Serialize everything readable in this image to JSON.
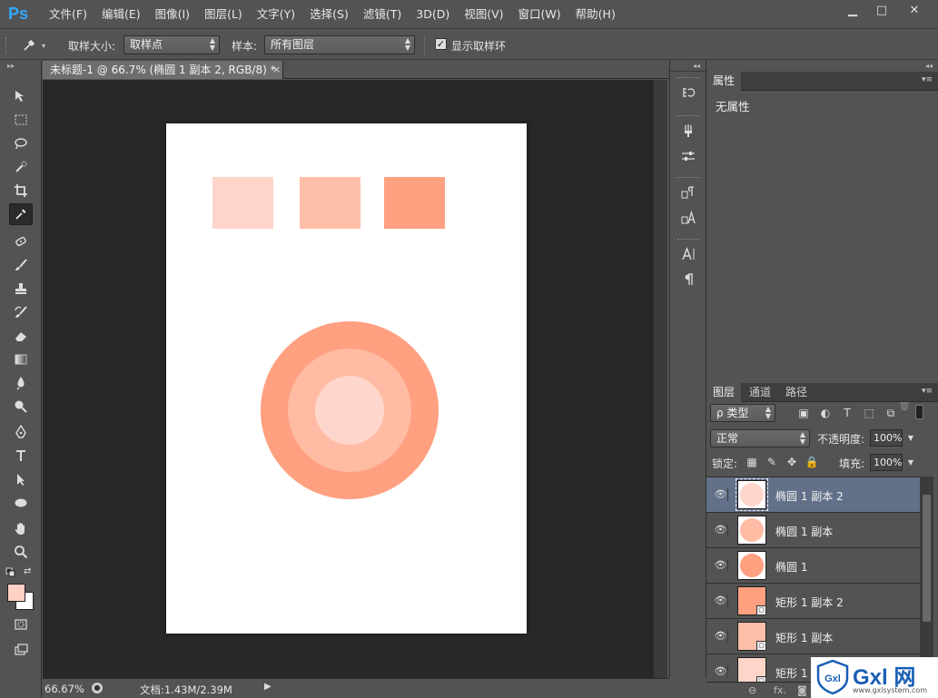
{
  "app": {
    "logo": "Ps"
  },
  "menu": [
    "文件(F)",
    "编辑(E)",
    "图像(I)",
    "图层(L)",
    "文字(Y)",
    "选择(S)",
    "滤镜(T)",
    "3D(D)",
    "视图(V)",
    "窗口(W)",
    "帮助(H)"
  ],
  "window_controls": {
    "minimize": "▁",
    "maximize": "□",
    "close": "✕"
  },
  "options": {
    "sample_size_label": "取样大小:",
    "sample_size_value": "取样点",
    "sample_label": "样本:",
    "sample_value": "所有图层",
    "show_ring_checked": "✓",
    "show_ring_label": "显示取样环"
  },
  "document": {
    "tab_title": "未标题-1 @ 66.7% (椭圆 1 副本 2, RGB/8) *",
    "tab_close": "×",
    "colors": {
      "rect1": "#ffd5ca",
      "rect2": "#ffbea8",
      "rect3": "#ffa081",
      "circle_outer": "#ffa081",
      "circle_mid": "#ffbba3",
      "circle_inner": "#ffd6cb"
    }
  },
  "status": {
    "zoom": "66.67%",
    "doc_info": "文档:1.43M/2.39M",
    "arrow": "▶"
  },
  "toolbar": {
    "collapse": "▸▸",
    "foreground_color": "#ffd0c4",
    "background_color": "#ffffff"
  },
  "midcol": {
    "collapse": "◂◂"
  },
  "properties": {
    "tab": "属性",
    "menu": "▾≡",
    "content": "无属性"
  },
  "layers": {
    "tabs": [
      "图层",
      "通道",
      "路径"
    ],
    "menu": "▾≡",
    "filter_type": "ρ 类型",
    "blend_mode": "正常",
    "opacity_label": "不透明度:",
    "opacity_value": "100%",
    "lock_label": "锁定:",
    "fill_label": "填充:",
    "fill_value": "100%",
    "items": [
      {
        "name": "椭圆 1 副本 2",
        "kind": "ellipse",
        "color": "#ffd6cb",
        "selected": true
      },
      {
        "name": "椭圆 1 副本",
        "kind": "ellipse",
        "color": "#ffbba3",
        "selected": false
      },
      {
        "name": "椭圆 1",
        "kind": "ellipse",
        "color": "#ffa081",
        "selected": false
      },
      {
        "name": "矩形 1 副本 2",
        "kind": "rect",
        "color": "#ffa081",
        "selected": false
      },
      {
        "name": "矩形 1 副本",
        "kind": "rect",
        "color": "#ffbea8",
        "selected": false
      },
      {
        "name": "矩形 1",
        "kind": "rect",
        "color": "#ffd5ca",
        "selected": false
      }
    ],
    "footer_fx": "fx."
  },
  "watermark": {
    "brand": "Gxl 网",
    "url": "www.gxlsystem.com"
  }
}
